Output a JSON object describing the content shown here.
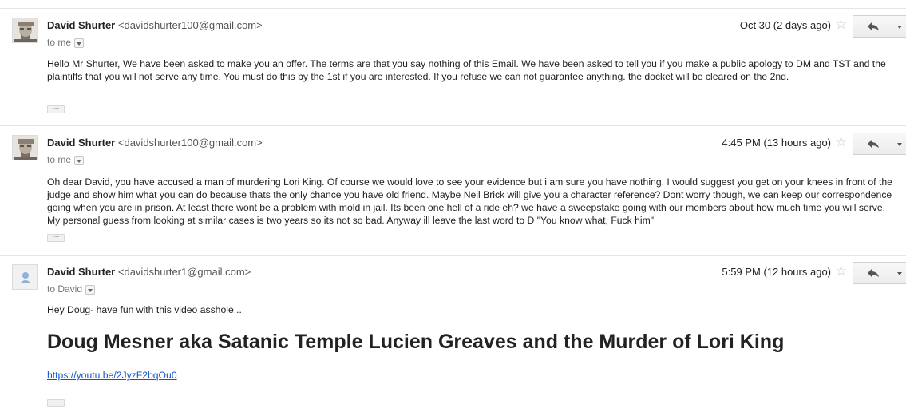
{
  "messages": [
    {
      "sender_name": "David Shurter",
      "sender_email": "<davidshurter100@gmail.com>",
      "recipient": "to me",
      "date": "Oct 30 (2 days ago)",
      "avatar": "photo-avatar",
      "body": "Hello Mr Shurter, We have been asked to make you an offer. The terms are that you say nothing of this Email. We have been asked to tell you if you make a public apology to DM and TST and the plaintiffs that you will not serve any time. You must do this by the 1st if you are interested. If you refuse we can not guarantee anything. the docket will be cleared on the 2nd.",
      "ellipsis": "···"
    },
    {
      "sender_name": "David Shurter",
      "sender_email": "<davidshurter100@gmail.com>",
      "recipient": "to me",
      "date": "4:45 PM (13 hours ago)",
      "avatar": "photo-avatar",
      "body": "Oh dear David, you have accused a man of murdering Lori King. Of course we would love to see your evidence but i am sure you have nothing. I would suggest you get on your knees in front of the judge and show him what you can do because thats the only chance you have old friend. Maybe Neil Brick will give you a character reference? Dont worry though, we can keep our correspondence going when you are in prison. At least there wont be a problem with mold in jail. Its been one hell of a ride eh? we have a sweepstake going with our members about how much time you will serve. My personal guess from looking at similar cases is two years so its not so bad. Anyway ill leave the last word to D \"You know what, Fuck him\"",
      "ellipsis": "···"
    },
    {
      "sender_name": "David Shurter",
      "sender_email": "<davidshurter1@gmail.com>",
      "recipient": "to David",
      "date": "5:59 PM (12 hours ago)",
      "avatar": "default-person-avatar",
      "body": "Hey Doug- have fun with this video asshole...",
      "headline": "Doug Mesner aka Satanic Temple Lucien Greaves and the Murder of Lori King",
      "link": "https://youtu.be/2JyzF2bqOu0",
      "ellipsis": "···"
    }
  ],
  "icons": {
    "star": "☆",
    "reply": "reply-icon",
    "more": "chevron-down-icon"
  },
  "colors": {
    "link": "#1155cc",
    "border": "#e5e5e5",
    "star": "#c8c8c8"
  }
}
